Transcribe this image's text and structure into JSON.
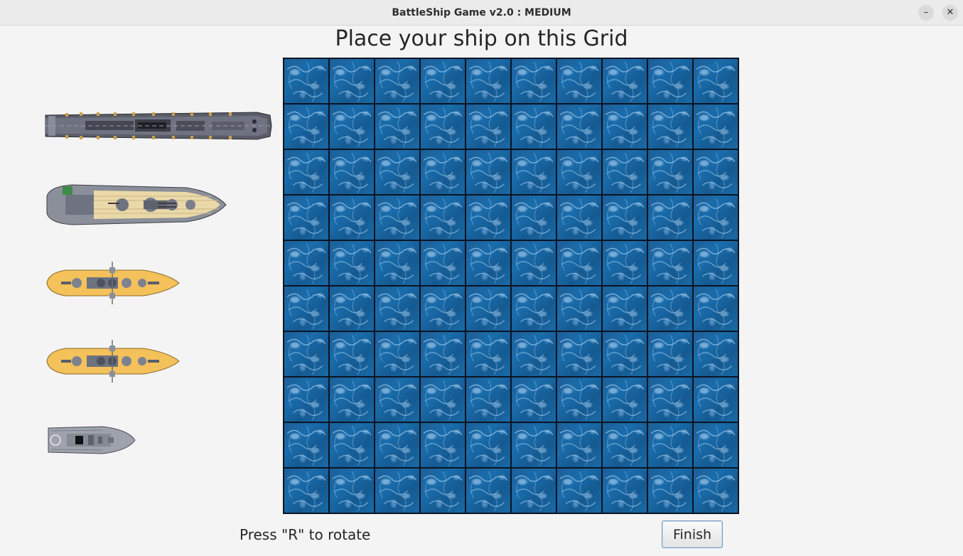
{
  "window": {
    "title": "BattleShip Game v2.0 : MEDIUM",
    "minimize_glyph": "–",
    "close_glyph": "✕"
  },
  "heading": "Place your ship on this Grid",
  "ships": [
    {
      "name": "carrier",
      "icon": "aircraft-carrier-icon"
    },
    {
      "name": "battleship",
      "icon": "battleship-icon"
    },
    {
      "name": "cruiser",
      "icon": "cruiser-icon"
    },
    {
      "name": "submarine",
      "icon": "submarine-icon"
    },
    {
      "name": "destroyer",
      "icon": "patrol-boat-icon"
    }
  ],
  "grid": {
    "rows": 10,
    "columns": 10,
    "cell_texture": "water-tile-icon"
  },
  "hint": "Press \"R\" to rotate",
  "finish_label": "Finish",
  "colors": {
    "water": "#1a6aa6",
    "grid_line": "#0b1422",
    "yellow_deck": "#f4c15a",
    "tan_deck": "#ead9a8",
    "hull_gray": "#7d8290"
  }
}
